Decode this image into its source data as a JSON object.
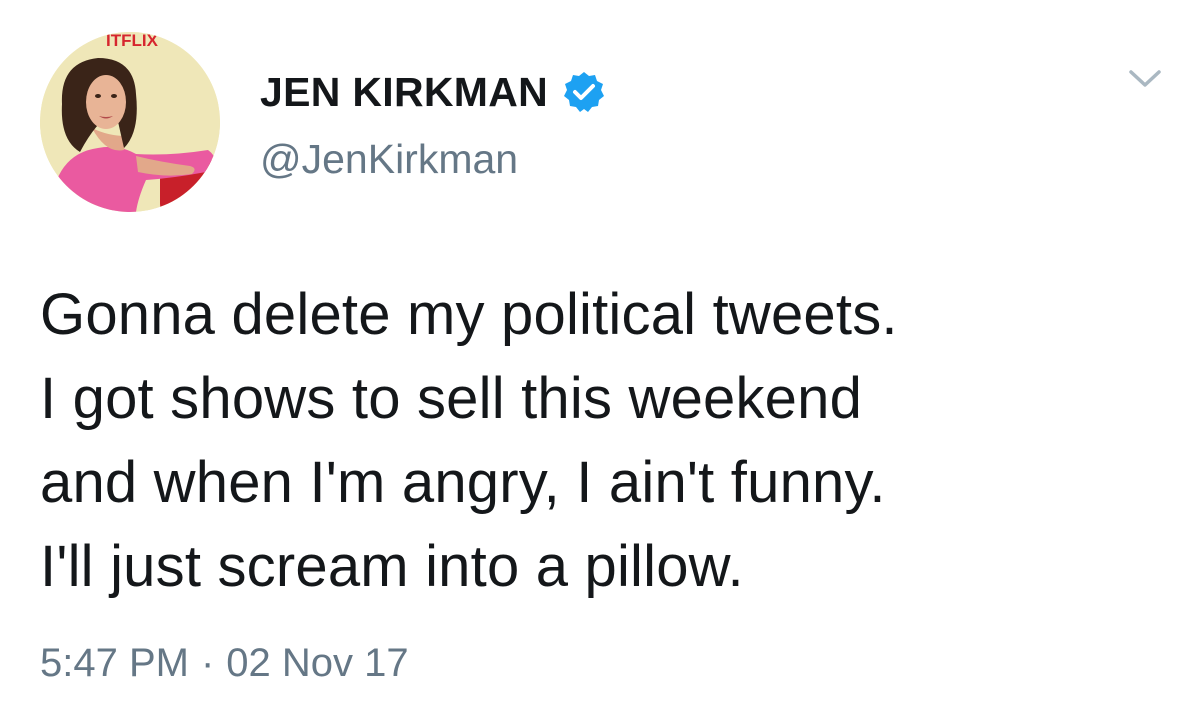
{
  "author": {
    "display_name": "JEN KIRKMAN",
    "handle": "@JenKirkman",
    "verified": true,
    "avatar_logo_text": "ITFLIX"
  },
  "tweet": {
    "lines": [
      "Gonna delete my political tweets.",
      "I got shows to sell this weekend",
      "and when I'm angry, I ain't funny.",
      "I'll just scream into a pillow."
    ],
    "time": "5:47 PM",
    "separator": "·",
    "date": "02 Nov 17"
  },
  "icons": {
    "verified": "verified-badge-icon",
    "caret": "chevron-down-icon"
  },
  "colors": {
    "text": "#14171a",
    "secondary": "#657786",
    "verified": "#1da1f2",
    "avatar_bg": "#efe7b8",
    "logo_red": "#d6262e"
  }
}
